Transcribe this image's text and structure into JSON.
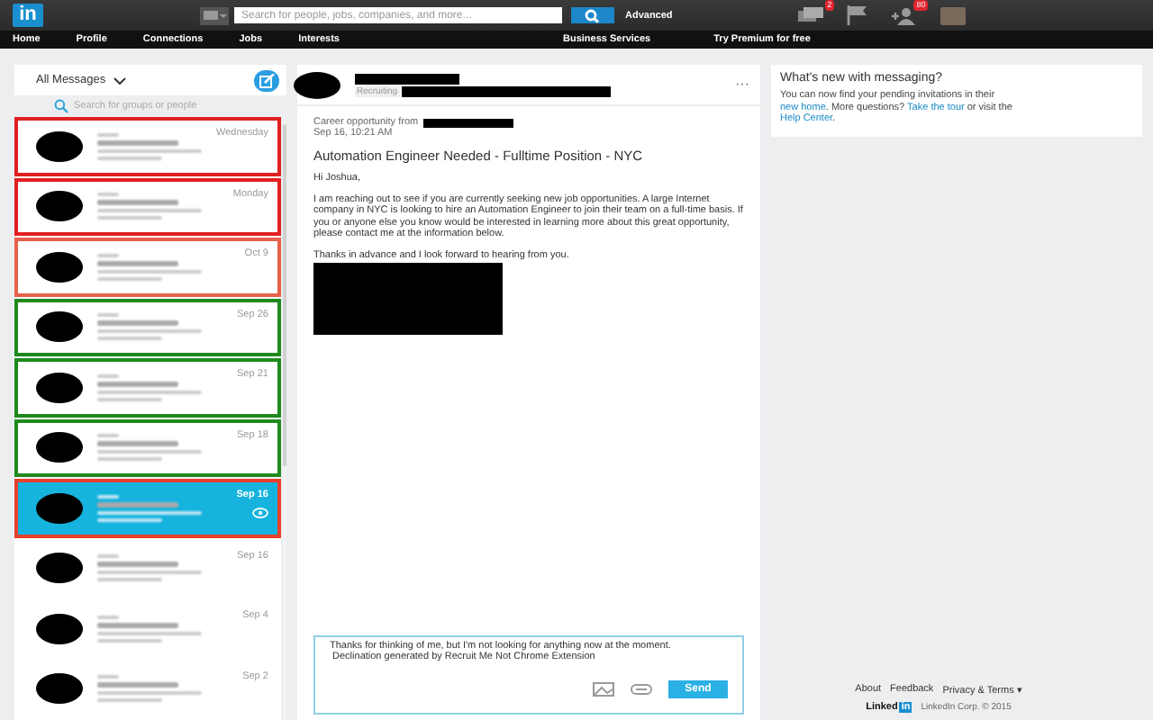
{
  "header": {
    "logo": "in",
    "search": {
      "placeholder": "Search for people, jobs, companies, and more..."
    },
    "advanced": "Advanced",
    "icons": [
      {
        "kind": "messages",
        "count": "2"
      },
      {
        "kind": "flag"
      },
      {
        "kind": "people",
        "count": "80"
      }
    ]
  },
  "nav": {
    "left": [
      "Home",
      "Profile",
      "Connections",
      "Jobs",
      "Interests"
    ],
    "right": [
      "Business Services",
      "Try Premium for free"
    ]
  },
  "inbox": {
    "filter": "All Messages",
    "search": {
      "placeholder": "Search for groups or people"
    },
    "conversations": [
      {
        "date": "Wednesday",
        "color": "#e02020",
        "selected": false
      },
      {
        "date": "Monday",
        "color": "#e02020",
        "selected": false
      },
      {
        "date": "Oct 9",
        "color": "#e8604a",
        "selected": false
      },
      {
        "date": "Sep 26",
        "color": "#1e8a1e",
        "selected": false
      },
      {
        "date": "Sep 21",
        "color": "#1e8a1e",
        "selected": false
      },
      {
        "date": "Sep 18",
        "color": "#1e8a1e",
        "selected": false
      },
      {
        "date": "Sep 16",
        "color": "#e8402a",
        "selected": true
      },
      {
        "date": "Sep 16",
        "selected": false
      },
      {
        "date": "Sep 4",
        "selected": false
      },
      {
        "date": "Sep 2",
        "selected": false
      }
    ]
  },
  "message": {
    "label": "Recruiting",
    "more": "···",
    "from_label": "Career opportunity from",
    "time": "Sep 16, 10:21 AM",
    "subject": "Automation Engineer Needed - Fulltime Position - NYC",
    "greeting": "Hi Joshua,",
    "body": "I am reaching out to see if you are currently seeking new job opportunities. A large Internet company in NYC is looking to hire an Automation Engineer to join their team on a full-time basis. If you or anyone else you know would be interested in learning more about this great opportunity, please contact me at the information below.",
    "closing": "Thanks in advance and I look forward to hearing from you."
  },
  "reply": {
    "value": "Thanks for thinking of me, but I'm not looking for anything now at the moment.\n Declination generated by Recruit Me Not Chrome Extension",
    "send": "Send"
  },
  "news": {
    "title": "What's new with messaging?",
    "text": [
      {
        "text": "You can now find your pending invitations in their "
      },
      {
        "text": "new home",
        "link": true
      },
      {
        "text": ". More questions? "
      },
      {
        "text": "Take the tour",
        "link": true
      },
      {
        "text": " or visit the "
      },
      {
        "text": "Help Center",
        "link": true
      },
      {
        "text": "."
      }
    ]
  },
  "footer": {
    "links": [
      "About",
      "Feedback",
      "Privacy & Terms ▾"
    ],
    "logo": [
      "Linked",
      "in"
    ],
    "copyright": "LinkedIn Corp. © 2015"
  }
}
